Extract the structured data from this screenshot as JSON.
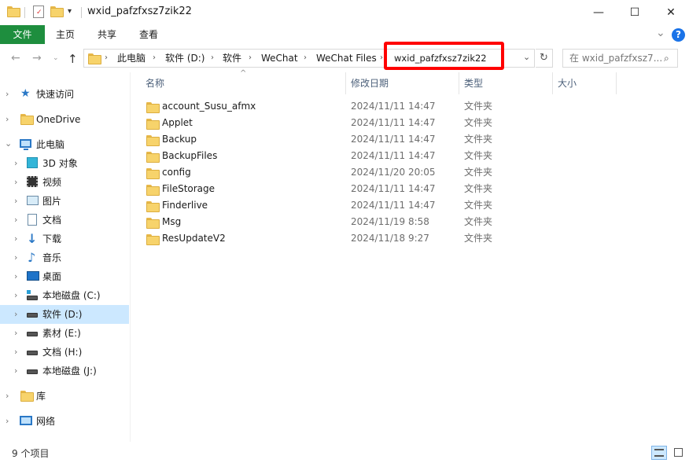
{
  "window": {
    "title": "wxid_pafzfxsz7zik22",
    "minimize": "—",
    "maximize": "☐",
    "close": "✕"
  },
  "ribbon": {
    "tabs": [
      {
        "label": "文件"
      },
      {
        "label": "主页"
      },
      {
        "label": "共享"
      },
      {
        "label": "查看"
      }
    ],
    "expand": "⌄",
    "help": "?"
  },
  "address": {
    "crumbs": [
      "此电脑",
      "软件 (D:)",
      "软件",
      "WeChat",
      "WeChat Files",
      "wxid_pafzfxsz7zik22"
    ]
  },
  "search": {
    "placeholder": "在 wxid_pafzfxsz7..."
  },
  "sidebar": {
    "quick_access": "快速访问",
    "onedrive": "OneDrive",
    "this_pc": "此电脑",
    "items": [
      {
        "label": "3D 对象"
      },
      {
        "label": "视频"
      },
      {
        "label": "图片"
      },
      {
        "label": "文档"
      },
      {
        "label": "下载"
      },
      {
        "label": "音乐"
      },
      {
        "label": "桌面"
      },
      {
        "label": "本地磁盘 (C:)"
      },
      {
        "label": "软件 (D:)"
      },
      {
        "label": "素材 (E:)"
      },
      {
        "label": "文档 (H:)"
      },
      {
        "label": "本地磁盘 (J:)"
      }
    ],
    "libraries": "库",
    "network": "网络"
  },
  "columns": {
    "name": "名称",
    "date": "修改日期",
    "type": "类型",
    "size": "大小"
  },
  "files": [
    {
      "name": "account_Susu_afmx",
      "date": "2024/11/11 14:47",
      "type": "文件夹"
    },
    {
      "name": "Applet",
      "date": "2024/11/11 14:47",
      "type": "文件夹"
    },
    {
      "name": "Backup",
      "date": "2024/11/11 14:47",
      "type": "文件夹"
    },
    {
      "name": "BackupFiles",
      "date": "2024/11/11 14:47",
      "type": "文件夹"
    },
    {
      "name": "config",
      "date": "2024/11/20 20:05",
      "type": "文件夹"
    },
    {
      "name": "FileStorage",
      "date": "2024/11/11 14:47",
      "type": "文件夹"
    },
    {
      "name": "Finderlive",
      "date": "2024/11/11 14:47",
      "type": "文件夹"
    },
    {
      "name": "Msg",
      "date": "2024/11/19 8:58",
      "type": "文件夹"
    },
    {
      "name": "ResUpdateV2",
      "date": "2024/11/18 9:27",
      "type": "文件夹"
    }
  ],
  "status": {
    "count": "9 个项目"
  },
  "colors": {
    "file_tab": "#1e8e3e",
    "selection": "#cce8ff",
    "highlight": "#ff0000",
    "help_icon": "#1a73e8"
  }
}
